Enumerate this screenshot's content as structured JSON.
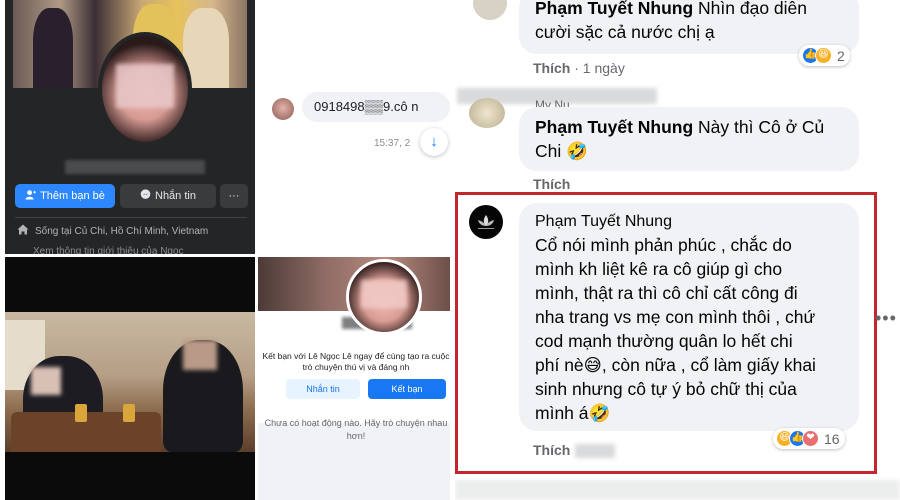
{
  "profile_panel": {
    "add_friend_label": "Thêm bạn bè",
    "message_label": "Nhắn tin",
    "more_label": "···",
    "lives_in": "Sống tại Củ Chi, Hồ Chí Minh, Vietnam",
    "see_intro": "Xem thông tin giới thiệu của Ngọc"
  },
  "chat_panel": {
    "message_text": "0918498▒▒9.cô n",
    "timestamp": "15:37, 2",
    "scroll_icon": "arrow-down-icon"
  },
  "mobile_profile": {
    "connect_text": "Kết bạn với Lê Ngọc Lê ngay để cùng tạo ra cuộc trò chuyện thú vị và đáng nh",
    "message_button": "Nhắn tin",
    "add_friend_button": "Kết bạn",
    "empty_activity": "Chưa có hoạt động nào. Hãy trò chuyện nhau hơn!"
  },
  "comments": {
    "first": {
      "name": "Phạm Tuyết Nhung",
      "text_line1": "Nhìn đạo diễn",
      "text_line2": "cười sặc cả nước chị ạ",
      "like_label": "Thích",
      "time": "1 ngày",
      "reaction_count": "2"
    },
    "second": {
      "reply_label": "My Nu",
      "name": "Phạm Tuyết Nhung",
      "text_first": "Này thì Cô ở Củ",
      "text_second": "Chi 🤣",
      "like_label": "Thích"
    },
    "highlighted": {
      "name": "Phạm Tuyết Nhung",
      "lines": [
        "Cổ nói mình phản phúc , chắc do",
        "mình kh liệt kê ra cô giúp gì cho",
        "mình, thật ra thì cô chỉ cất công đi",
        "nha trang vs mẹ con mình thôi , chứ",
        "cod mạnh thường quân lo hết chi",
        "phí nè😅, còn nữa , cổ làm giấy khai",
        "sinh nhưng cô tự ý bỏ chữ thị của",
        "mình á🤣"
      ],
      "like_label": "Thích",
      "reaction_count": "16",
      "more_icon": "more-dots-icon"
    }
  },
  "colors": {
    "highlight_border": "#c4262e",
    "facebook_blue": "#1877f2",
    "dark_bg": "#242526"
  }
}
